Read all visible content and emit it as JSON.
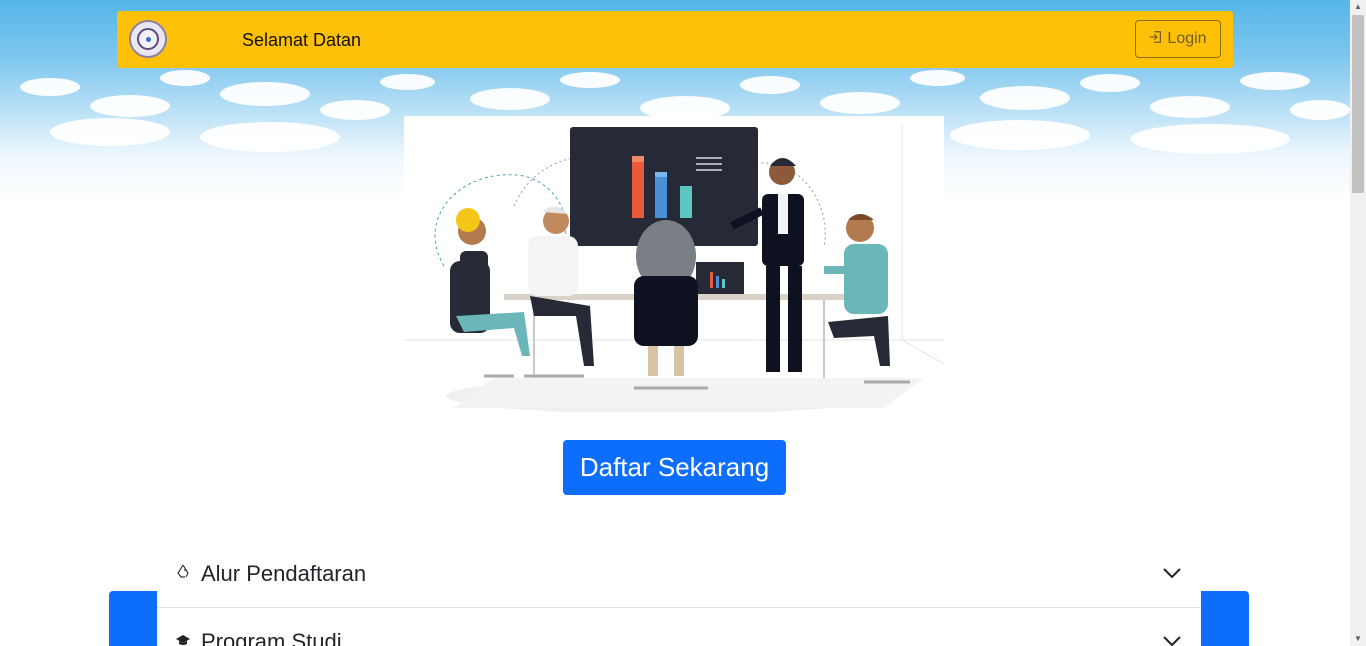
{
  "navbar": {
    "marquee_text": "Selamat Datan",
    "login_label": "Login"
  },
  "hero": {
    "cta_label": "Daftar Sekarang"
  },
  "accordion": {
    "items": [
      {
        "label": "Alur Pendaftaran",
        "icon": "recycle-icon"
      },
      {
        "label": "Program Studi",
        "icon": "graduation-cap-icon"
      }
    ]
  },
  "colors": {
    "navbar": "#ffc107",
    "primary": "#0d6efd",
    "sky": "#56b6ea"
  }
}
